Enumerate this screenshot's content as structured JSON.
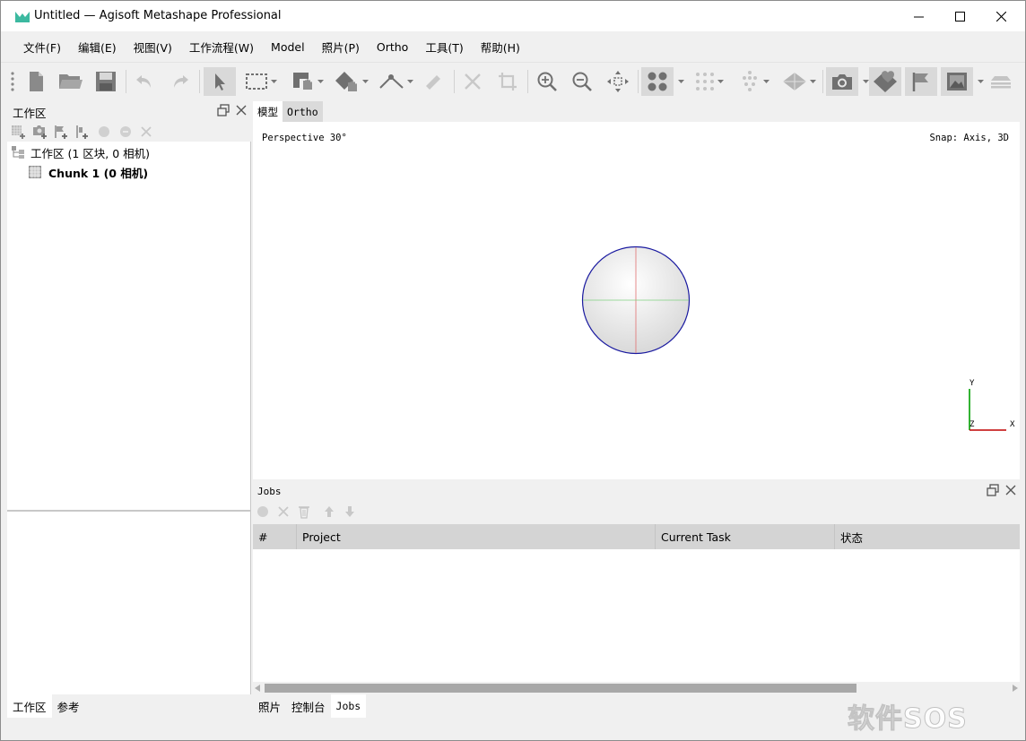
{
  "window": {
    "title": "Untitled — Agisoft Metashape Professional"
  },
  "menu": [
    "文件(F)",
    "编辑(E)",
    "视图(V)",
    "工作流程(W)",
    "Model",
    "照片(P)",
    "Ortho",
    "工具(T)",
    "帮助(H)"
  ],
  "workspace": {
    "title": "工作区",
    "root_label": "工作区 (1 区块, 0 相机)",
    "chunk_label": "Chunk 1 (0 相机)",
    "tabs": [
      "工作区",
      "参考"
    ]
  },
  "model_view": {
    "tabs": [
      "模型",
      "Ortho"
    ],
    "perspective_label": "Perspective 30°",
    "snap_label": "Snap: Axis, 3D",
    "axes": {
      "y": "Y",
      "x": "X",
      "z": "Z"
    }
  },
  "jobs": {
    "title": "Jobs",
    "columns": [
      "#",
      "Project",
      "Current Task",
      "状态"
    ]
  },
  "bottom_tabs": [
    "照片",
    "控制台",
    "Jobs"
  ],
  "watermark": "软件SOS",
  "colors": {
    "accent_green": "#3cb9a0",
    "sphere_outline": "#1a1aa0",
    "axis_x": "#c00000",
    "axis_y": "#00a000"
  }
}
